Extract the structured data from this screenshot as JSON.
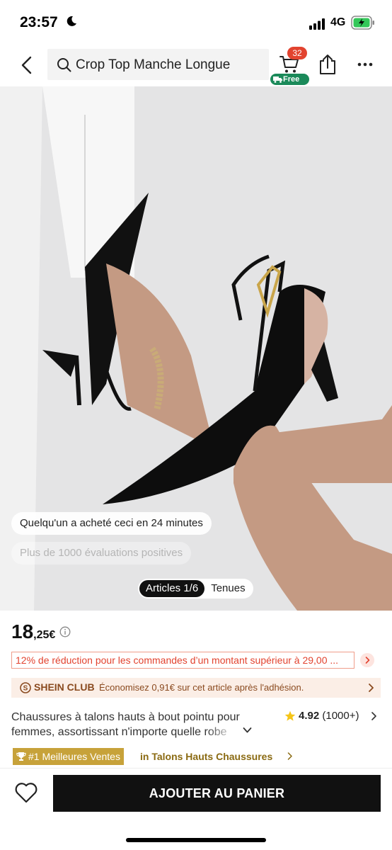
{
  "status_bar": {
    "time": "23:57",
    "network": "4G"
  },
  "header": {
    "search_text": "Crop Top Manche Longue",
    "cart_count": "32",
    "free_label": "Free"
  },
  "gallery": {
    "recent_purchase": "Quelqu'un a acheté ceci en 24 minutes",
    "positive_reviews": "Plus de 1000 évaluations positives",
    "tabs": [
      {
        "label": "Articles 1/6",
        "active": true
      },
      {
        "label": "Tenues",
        "active": false
      }
    ]
  },
  "product": {
    "price_integer": "18",
    "price_decimal": ",25€",
    "promo": "12% de réduction pour les commandes d’un montant supérieur à 29,00 ...",
    "club_name": "SHEIN CLUB",
    "club_text": "Économisez 0,91€ sur cet article après l'adhésion.",
    "title": "Chaussures à talons hauts à bout pointu pour femmes, assortissant n'importe quelle robe",
    "rating": "4.92",
    "rating_count": "(1000+)",
    "best_seller_badge": "#1 Meilleures Ventes",
    "best_seller_category": "in Talons Hauts Chaussures"
  },
  "bottom_bar": {
    "add_to_cart": "AJOUTER AU PANIER"
  },
  "colors": {
    "accent_red": "#e2432f",
    "free_green": "#1b8a5a",
    "club_brown": "#8a4a1f",
    "best_gold": "#c7a23a",
    "button_black": "#111111"
  },
  "icons": [
    "moon-icon",
    "signal-icon",
    "battery-icon",
    "back-icon",
    "search-icon",
    "cart-icon",
    "truck-icon",
    "share-icon",
    "more-icon",
    "info-icon",
    "chevron-right-icon",
    "shein-club-logo-icon",
    "chevron-down-icon",
    "star-icon",
    "trophy-icon",
    "heart-icon"
  ]
}
